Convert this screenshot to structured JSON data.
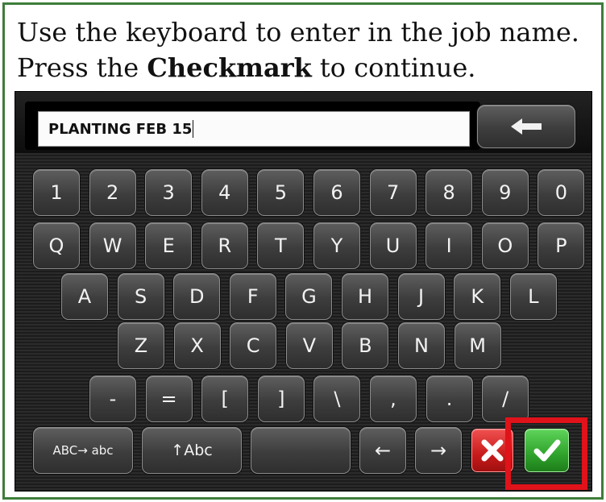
{
  "instruction": {
    "line1": "Use the keyboard to enter in the job name.",
    "line2_before": "Press the ",
    "line2_bold": "Checkmark",
    "line2_after": " to continue."
  },
  "entry": {
    "value": "PLANTING FEB 15"
  },
  "keys": {
    "row1": [
      "1",
      "2",
      "3",
      "4",
      "5",
      "6",
      "7",
      "8",
      "9",
      "0"
    ],
    "row2": [
      "Q",
      "W",
      "E",
      "R",
      "T",
      "Y",
      "U",
      "I",
      "O",
      "P"
    ],
    "row3": [
      "A",
      "S",
      "D",
      "F",
      "G",
      "H",
      "J",
      "K",
      "L"
    ],
    "row4": [
      "Z",
      "X",
      "C",
      "V",
      "B",
      "N",
      "M"
    ],
    "row5": [
      "-",
      "=",
      "[",
      "]",
      "\\",
      ",",
      ".",
      "/"
    ]
  },
  "bottom": {
    "case_toggle": "ABC→ abc",
    "shift": "↑Abc",
    "left_arrow": "←",
    "right_arrow": "→"
  },
  "icons": {
    "backspace": "left-arrow-icon",
    "cancel": "x-icon",
    "confirm": "checkmark-icon"
  },
  "colors": {
    "frame_border": "#3e7d3a",
    "highlight": "#e0121a",
    "cancel": "#c81b1b",
    "confirm": "#2fa32b"
  }
}
